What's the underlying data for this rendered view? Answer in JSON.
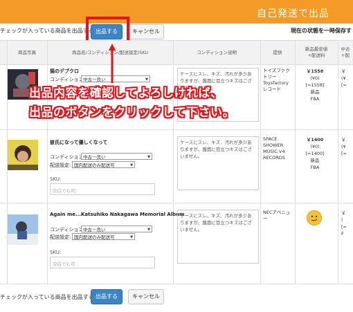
{
  "window": {
    "title": "自己発送で出品"
  },
  "toolbar": {
    "prompt": "チェックが入っている商品を出品する:",
    "submit_label": "出品する",
    "cancel_label": "キャンセル",
    "status": "現在の状態を一時保存す"
  },
  "table": {
    "headers": [
      "商品写真",
      "商品名/コンディション/配送設定/SKU",
      "コンディション説明",
      "提供",
      "新品最安値\n+配送料",
      "中古\n+配"
    ]
  },
  "rows": [
    {
      "name": "猫のデブクロ",
      "condition_label": "コンディション:",
      "condition": "中古－良い",
      "shipping_label": "",
      "shipping": "",
      "sku_label": "",
      "sku_placeholder": "",
      "description": "ケースにスレ、キズ、汚れが多少ありますが、盤面に目立つキズはございません。",
      "maker": "トイズファクトリー\nToysfactory\nレコード",
      "price": "￥1558",
      "price_sub": "(¥0)",
      "price_total": "[=1558]",
      "price_cond": "新品",
      "price_ch": "FBA",
      "used_cut": "￥\n(¥\n[="
    },
    {
      "name": "彼氏になって優しくなって",
      "condition_label": "コンディション:",
      "condition": "中古－良い",
      "shipping_label": "配送設定:",
      "shipping": "国内配送のみ配送可",
      "sku_label": "SKU:",
      "sku_placeholder": "空白でも可",
      "description": "ケースにスレ、キズ、汚れが多少ありますが、盤面に目立つキズはございません。",
      "maker": "SPACE\nSHOWER\nMUSIC V4\nRECORDS",
      "price": "￥1400",
      "price_sub": "(¥0)",
      "price_total": "[=1400]",
      "price_cond": "新品",
      "price_ch": "FBA",
      "used_cut": "￥\n(¥\n[="
    },
    {
      "name": "Again me...Katsuhiko Nakagawa Memorial Album",
      "condition_label": "コンディション:",
      "condition": "中古－良い",
      "shipping_label": "配送設定:",
      "shipping": "国内配送のみ配送可",
      "sku_label": "SKU:",
      "sku_placeholder": "空白でも可",
      "description": "ケースにスレ、キズ、汚れが多少ありますが、盤面に目立つキズはございません。",
      "maker": "NECアベニュー",
      "price": "",
      "price_sub": "",
      "price_total": "",
      "price_cond": "",
      "price_ch": "",
      "used_cut": "￥\n(\n[=\nF"
    }
  ],
  "overlay": {
    "line1": "出品内容を確認してよろしければ、",
    "line2": "出品のボタンをクリックして下さい。"
  },
  "colors": {
    "title_bar": "#f39a27",
    "primary_button": "#3b84c6",
    "annotation_red": "#e4141a"
  }
}
